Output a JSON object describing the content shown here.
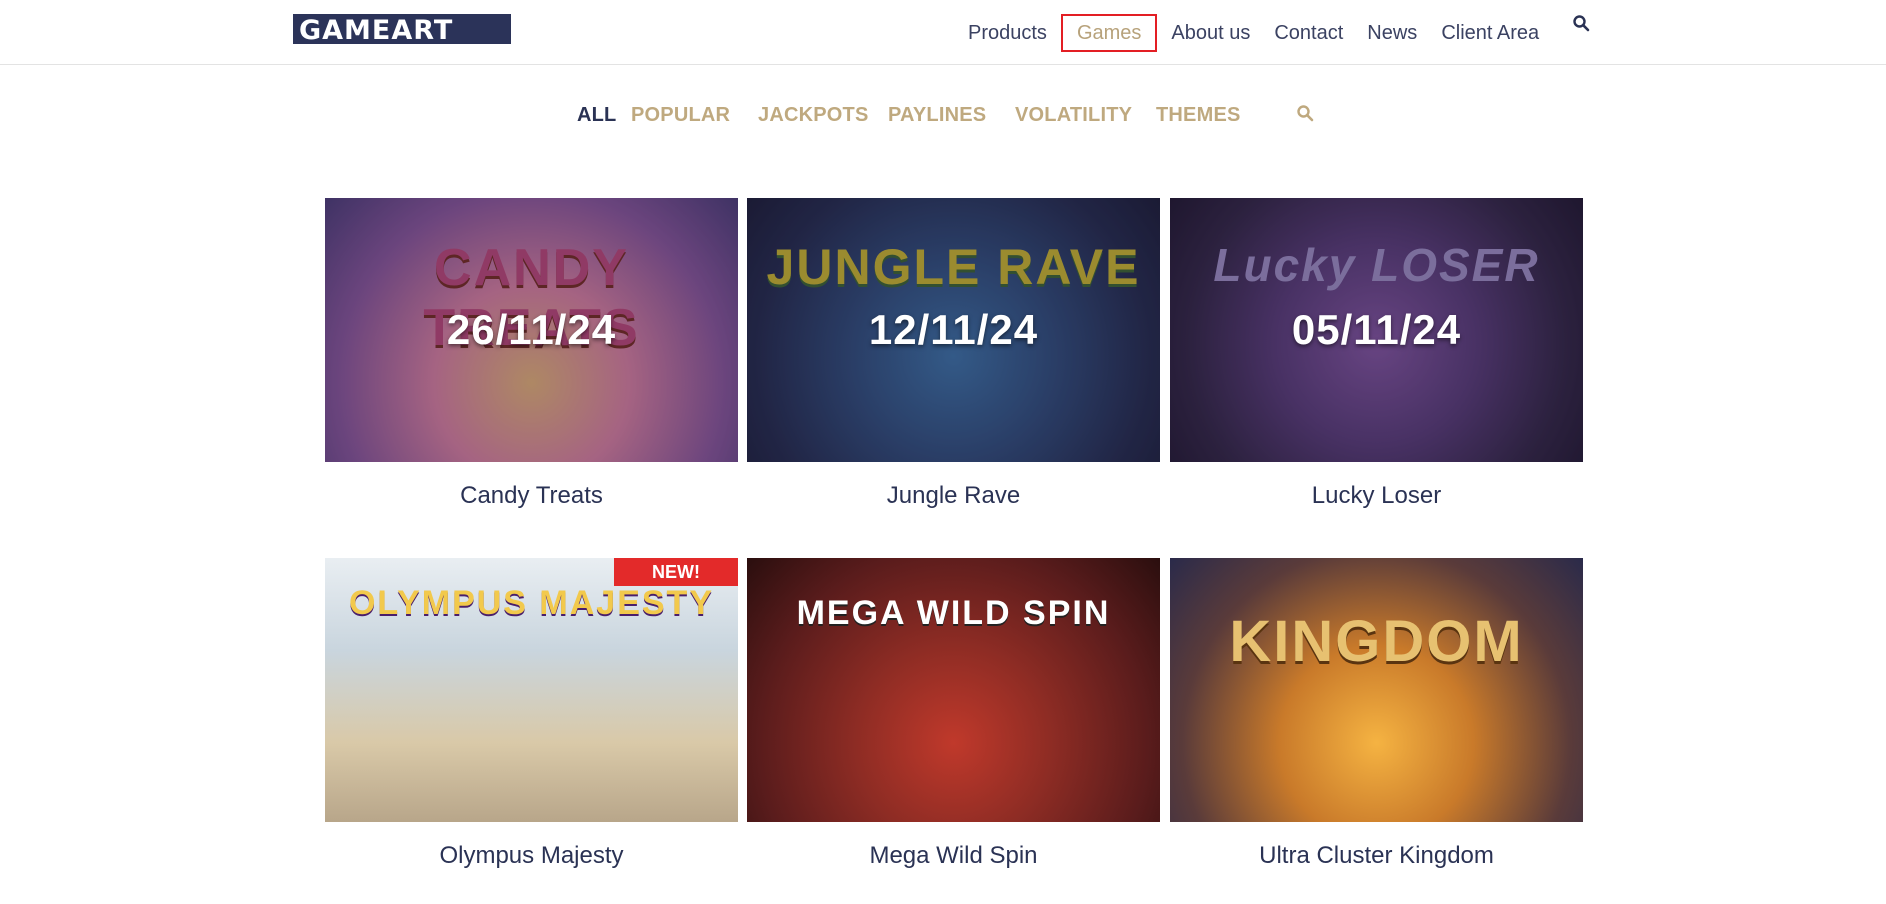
{
  "brand": {
    "logo": "GAMEART"
  },
  "nav": {
    "items": [
      {
        "label": "Products",
        "active": false
      },
      {
        "label": "Games",
        "active": true
      },
      {
        "label": "About us",
        "active": false
      },
      {
        "label": "Contact",
        "active": false
      },
      {
        "label": "News",
        "active": false
      },
      {
        "label": "Client Area",
        "active": false
      }
    ],
    "search_icon": "search-icon"
  },
  "filters": {
    "items": [
      "ALL",
      "POPULAR",
      "JACKPOTS",
      "PAYLINES",
      "VOLATILITY",
      "THEMES"
    ],
    "active": "ALL",
    "search_icon": "search-icon"
  },
  "games": [
    {
      "title": "Candy Treats",
      "date": "26/11/24",
      "art": "CANDY TREATS"
    },
    {
      "title": "Jungle Rave",
      "date": "12/11/24",
      "art": "JUNGLE RAVE"
    },
    {
      "title": "Lucky Loser",
      "date": "05/11/24",
      "art": "Lucky LOSER"
    },
    {
      "title": "Olympus Majesty",
      "badge": "NEW!",
      "art": "OLYMPUS MAJESTY"
    },
    {
      "title": "Mega Wild Spin",
      "art": "MEGA WILD SPIN"
    },
    {
      "title": "Ultra Cluster Kingdom",
      "art": "KINGDOM"
    }
  ],
  "colors": {
    "navy": "#2a3254",
    "gold": "#bfa97f",
    "active_border": "#e31e24",
    "badge": "#e32a2a"
  }
}
